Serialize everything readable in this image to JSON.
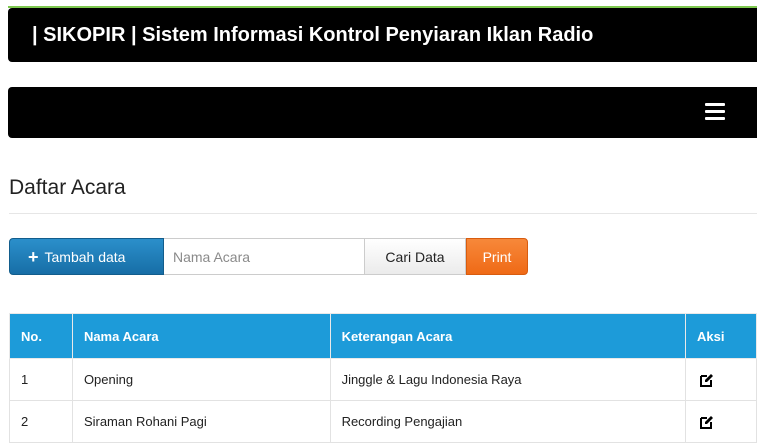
{
  "header": {
    "app_title": "| SIKOPIR | Sistem Informasi Kontrol Penyiaran Iklan Radio"
  },
  "navbar": {
    "menu_icon": "hamburger-menu-icon"
  },
  "page": {
    "title": "Daftar Acara"
  },
  "toolbar": {
    "add_icon": "plus-icon",
    "add_label": "Tambah data",
    "search_placeholder": "Nama Acara",
    "search_value": "",
    "search_label": "Cari Data",
    "print_label": "Print"
  },
  "table": {
    "headers": [
      "No.",
      "Nama Acara",
      "Keterangan Acara",
      "Aksi"
    ],
    "rows": [
      {
        "no": "1",
        "nama": "Opening",
        "keterangan": "Jinggle & Lagu Indonesia Raya",
        "aksi_icon": "edit-icon"
      },
      {
        "no": "2",
        "nama": "Siraman Rohani Pagi",
        "keterangan": "Recording Pengajian",
        "aksi_icon": "edit-icon"
      }
    ]
  },
  "colors": {
    "header_bg": "#000000",
    "accent_line": "#7ec850",
    "primary_button": "#1b81b8",
    "print_button": "#ef6a16",
    "table_header": "#1d9bd9"
  }
}
